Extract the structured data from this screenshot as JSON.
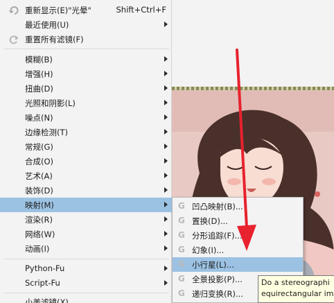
{
  "main_menu": {
    "items": [
      {
        "label": "重新显示(E)\"光晕\"",
        "shortcut": "Shift+Ctrl+F",
        "icon": "redo-icon"
      },
      {
        "label": "最近使用(U)"
      },
      {
        "label": "重置所有滤镜(F)",
        "icon": "reset-icon"
      },
      {
        "label": "模糊(B)"
      },
      {
        "label": "增强(H)"
      },
      {
        "label": "扭曲(D)"
      },
      {
        "label": "光照和阴影(L)"
      },
      {
        "label": "噪点(N)"
      },
      {
        "label": "边缘检测(T)"
      },
      {
        "label": "常规(G)"
      },
      {
        "label": "合成(O)"
      },
      {
        "label": "艺术(A)"
      },
      {
        "label": "装饰(D)"
      },
      {
        "label": "映射(M)"
      },
      {
        "label": "渲染(R)"
      },
      {
        "label": "网络(W)"
      },
      {
        "label": "动画(I)"
      },
      {
        "label": "Python-Fu"
      },
      {
        "label": "Script-Fu"
      },
      {
        "label": "小美滤镜(X)"
      }
    ]
  },
  "submenu": {
    "items": [
      {
        "label": "凹凸映射(B)..."
      },
      {
        "label": "置换(D)..."
      },
      {
        "label": "分形追踪(F)..."
      },
      {
        "label": "幻象(I)..."
      },
      {
        "label": "小行星(L)..."
      },
      {
        "label": "全景投影(P)..."
      },
      {
        "label": "递归变换(R)..."
      }
    ],
    "gegl_icon_glyph": "G"
  },
  "tooltip": {
    "line1": "Do a stereographi",
    "line2": "equirectangular im"
  },
  "colors": {
    "menu_bg": "#f3f3f3",
    "highlight": "#9cc2e3",
    "arrow": "#e8222e",
    "tooltip_bg": "#ffffe1"
  }
}
